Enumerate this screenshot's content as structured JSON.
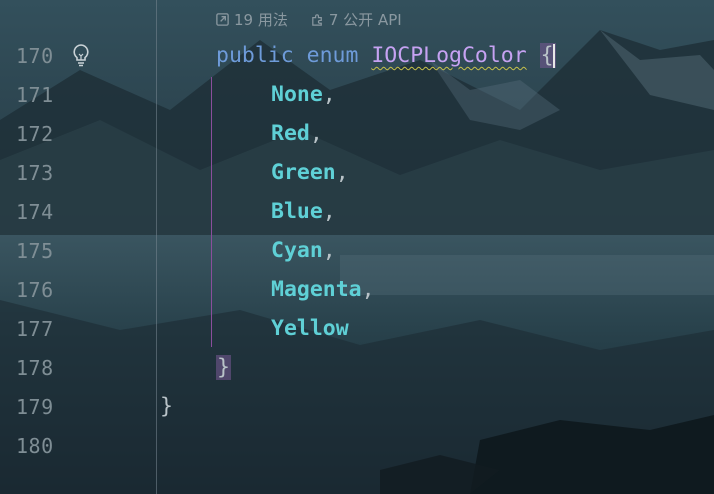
{
  "inlay_hints": {
    "usages": "19 用法",
    "api": "7 公开 API"
  },
  "icons": {
    "usages": "external-link-icon",
    "api": "puzzle-icon",
    "bulb": "lightbulb-icon"
  },
  "lines": [
    {
      "number": "170",
      "tokens": [
        "public",
        "enum",
        "IOCPLogColor",
        "{"
      ]
    },
    {
      "number": "171",
      "member": "None",
      "punc": ","
    },
    {
      "number": "172",
      "member": "Red",
      "punc": ","
    },
    {
      "number": "173",
      "member": "Green",
      "punc": ","
    },
    {
      "number": "174",
      "member": "Blue",
      "punc": ","
    },
    {
      "number": "175",
      "member": "Cyan",
      "punc": ","
    },
    {
      "number": "176",
      "member": "Magenta",
      "punc": ","
    },
    {
      "number": "177",
      "member": "Yellow",
      "punc": ""
    },
    {
      "number": "178",
      "closing": "}"
    },
    {
      "number": "179",
      "closing": "}"
    },
    {
      "number": "180"
    }
  ],
  "colors": {
    "keyword": "#6e9bd9",
    "class_name": "#c6a2f2",
    "enum_member": "#5fd0d6",
    "line_number": "#7f8e95"
  }
}
